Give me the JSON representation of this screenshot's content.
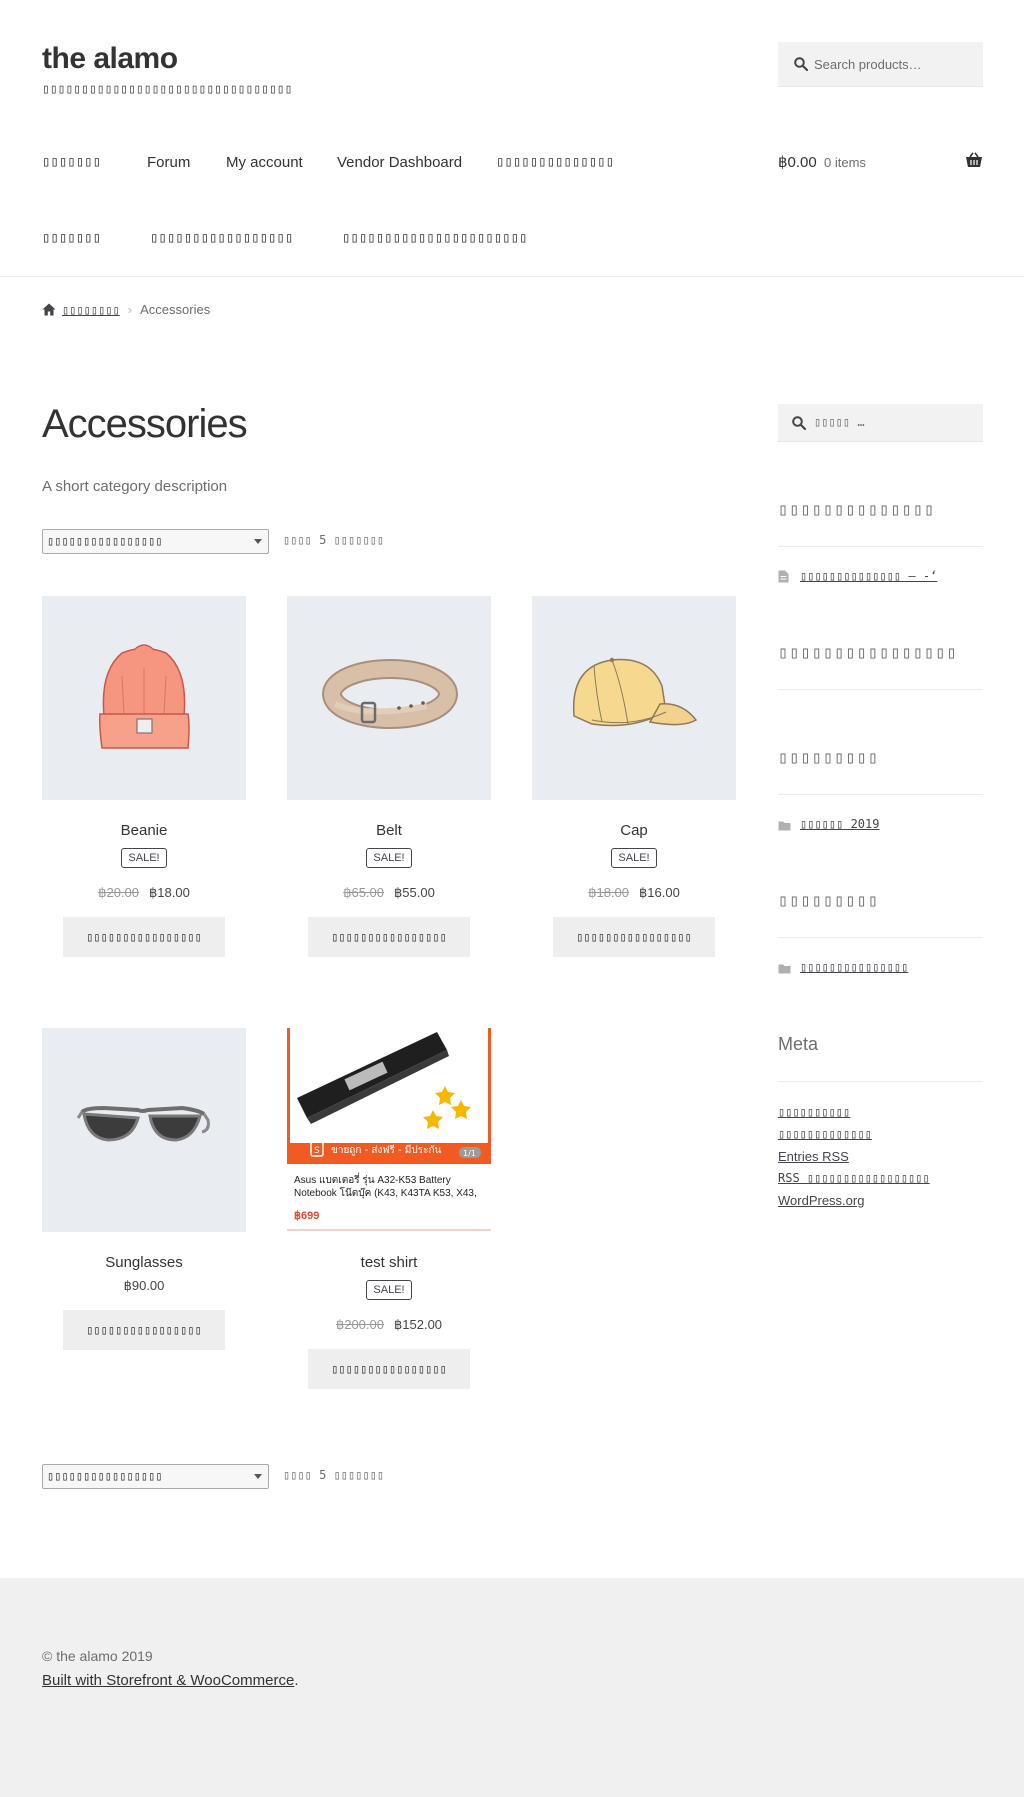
{
  "site": {
    "title": "the alamo",
    "tagline": "▯▯▯▯▯▯▯▯▯▯▯▯▯▯▯▯▯▯▯▯▯▯▯▯▯▯▯▯▯▯▯▯"
  },
  "header_search": {
    "placeholder": "Search products…"
  },
  "nav": {
    "row1": [
      "▯▯▯▯▯▯▯",
      "Forum",
      "My account",
      "Vendor Dashboard",
      "▯▯▯▯▯▯▯▯▯▯▯▯▯▯"
    ],
    "row2": [
      "▯▯▯▯▯▯▯",
      "▯▯▯▯▯▯▯▯▯▯▯▯▯▯▯▯▯",
      "▯▯▯▯▯▯▯▯▯▯▯▯▯▯▯▯▯▯▯▯▯▯"
    ]
  },
  "cart": {
    "amount": "฿0.00",
    "count": "0 items",
    "icon": "basket-icon"
  },
  "breadcrumb": {
    "home": "▯▯▯▯▯▯▯▯",
    "current": "Accessories"
  },
  "main": {
    "title": "Accessories",
    "description": "A short category description",
    "orderby": "▯▯▯▯▯▯▯▯▯▯▯▯▯▯▯▯",
    "result_count": "▯▯▯▯ 5 ▯▯▯▯▯▯▯"
  },
  "products": [
    {
      "name": "Beanie",
      "badge": "SALE!",
      "regular_price": "฿20.00",
      "price": "฿18.00",
      "button": "▯▯▯▯▯▯▯▯▯▯▯▯▯▯▯▯",
      "image": "beanie-image"
    },
    {
      "name": "Belt",
      "badge": "SALE!",
      "regular_price": "฿65.00",
      "price": "฿55.00",
      "button": "▯▯▯▯▯▯▯▯▯▯▯▯▯▯▯▯",
      "image": "belt-image"
    },
    {
      "name": "Cap",
      "badge": "SALE!",
      "regular_price": "฿18.00",
      "price": "฿16.00",
      "button": "▯▯▯▯▯▯▯▯▯▯▯▯▯▯▯▯",
      "image": "cap-image"
    },
    {
      "name": "Sunglasses",
      "badge": "",
      "regular_price": "",
      "price": "฿90.00",
      "button": "▯▯▯▯▯▯▯▯▯▯▯▯▯▯▯▯",
      "image": "sunglasses-image"
    },
    {
      "name": "test shirt",
      "badge": "SALE!",
      "regular_price": "฿200.00",
      "price": "฿152.00",
      "button": "▯▯▯▯▯▯▯▯▯▯▯▯▯▯▯▯",
      "image": "battery-ad-image"
    }
  ],
  "battery_ad": {
    "banner": "ขายถูก - ส่งฟรี - มีประกัน",
    "page": "1/1",
    "title_line1": "Asus แบตเตอรี่ รุ่น A32-K53 Battery",
    "title_line2": "Notebook โน๊ตบุ๊ค (K43, K43TA K53, X43,",
    "price": "฿699"
  },
  "sidebar": {
    "search_placeholder": "▯▯▯▯▯ …",
    "recent_posts_title": "▯▯▯▯▯▯▯▯▯▯▯▯▯▯",
    "recent_post": "▯▯▯▯▯▯▯▯▯▯▯▯▯▯ – -‘",
    "recent_comments_title": "▯▯▯▯▯▯▯▯▯▯▯▯▯▯▯▯",
    "archives_title": "▯▯▯▯▯▯▯▯▯",
    "archive_item": "▯▯▯▯▯▯ 2019",
    "categories_title": "▯▯▯▯▯▯▯▯▯",
    "category_item": "▯▯▯▯▯▯▯▯▯▯▯▯▯▯▯",
    "meta_title": "Meta",
    "meta_links": [
      "▯▯▯▯▯▯▯▯▯▯",
      "▯▯▯▯▯▯▯▯▯▯▯▯▯",
      "Entries RSS",
      "RSS ▯▯▯▯▯▯▯▯▯▯▯▯▯▯▯▯▯",
      "WordPress.org"
    ]
  },
  "footer": {
    "copyright": "© the alamo 2019",
    "built_with": "Built with Storefront & WooCommerce",
    "built_suffix": "."
  },
  "colors": {
    "page_bg": "#ffffff",
    "footer_bg": "#f0f0f0",
    "button_bg": "#eeeeee",
    "thumb_bg": "#e9edf2",
    "text": "#43454b",
    "ad_orange": "#f15a22"
  }
}
